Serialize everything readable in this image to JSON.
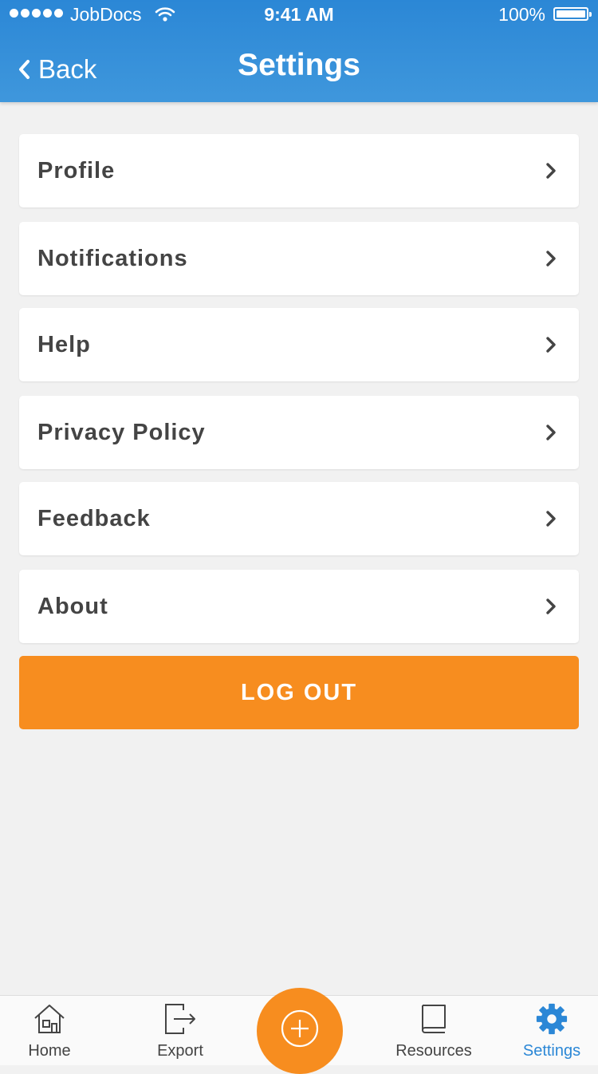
{
  "status_bar": {
    "carrier": "JobDocs",
    "time": "9:41 AM",
    "battery": "100%"
  },
  "header": {
    "back_label": "Back",
    "title": "Settings"
  },
  "menu": {
    "items": [
      {
        "label": "Profile"
      },
      {
        "label": "Notifications"
      },
      {
        "label": "Help"
      },
      {
        "label": "Privacy Policy"
      },
      {
        "label": "Feedback"
      },
      {
        "label": "About"
      }
    ]
  },
  "logout_label": "LOG OUT",
  "tab_bar": {
    "tabs": [
      {
        "label": "Home",
        "icon": "home-icon"
      },
      {
        "label": "Export",
        "icon": "export-icon"
      },
      {
        "label": "Resources",
        "icon": "book-icon"
      },
      {
        "label": "Settings",
        "icon": "gear-icon",
        "active": true
      }
    ],
    "fab_icon": "add-icon"
  },
  "colors": {
    "header_blue": "#2b87d6",
    "accent_orange": "#f78d1f",
    "background": "#f1f1f1",
    "active_tab": "#2b87d6"
  }
}
